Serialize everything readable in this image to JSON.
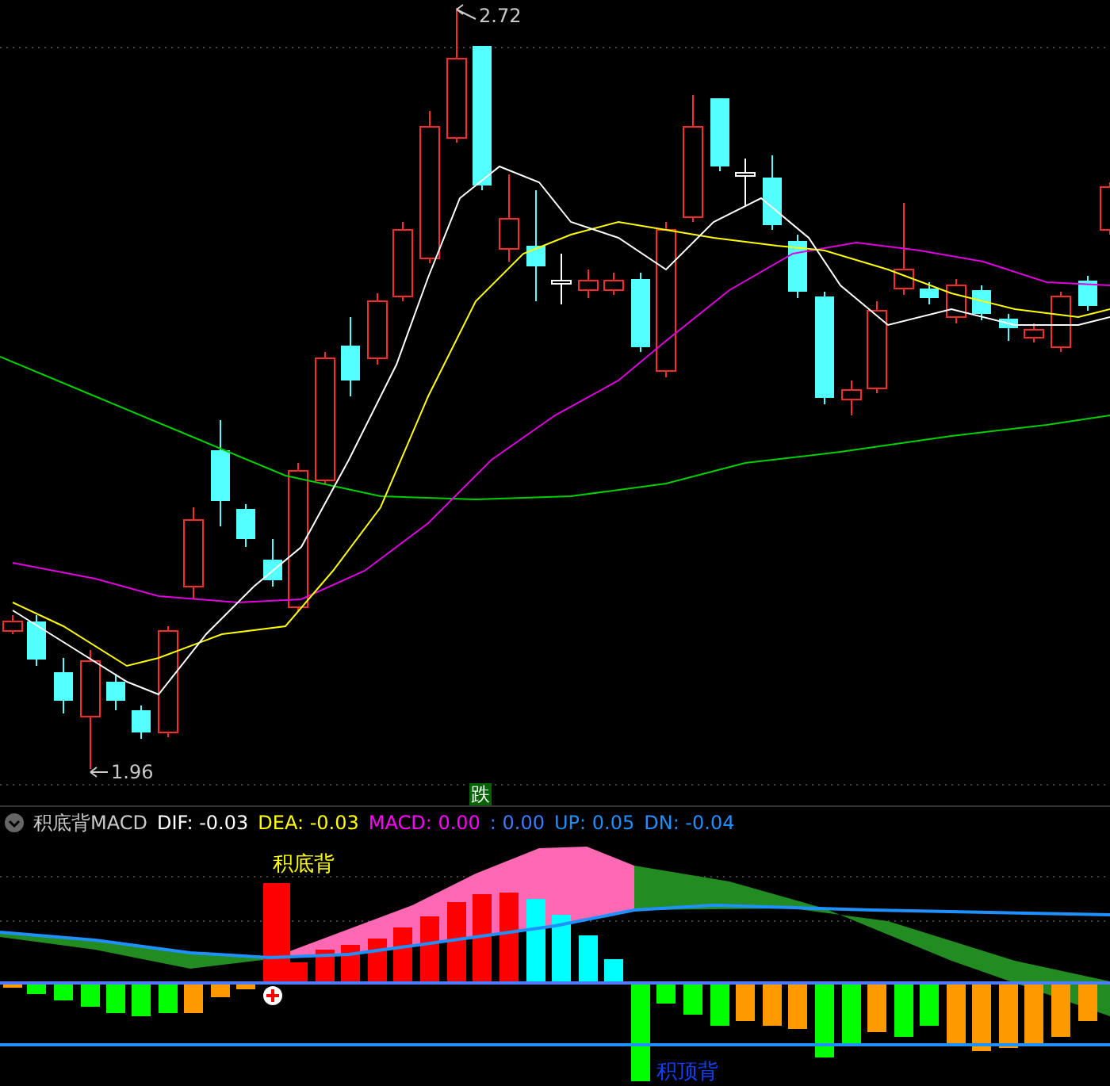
{
  "price_chart": {
    "high_label": "2.72",
    "low_label": "1.96",
    "signal_badge": "跌"
  },
  "indicator_header": {
    "name": "积底背MACD",
    "items": [
      {
        "text": "DIF: -0.03",
        "color": "#ffffff"
      },
      {
        "text": "DEA: -0.03",
        "color": "#ffff00"
      },
      {
        "text": "MACD: 0.00",
        "color": "#ff00ff"
      },
      {
        "text": ": 0.00",
        "color": "#3b7bff"
      },
      {
        "text": "UP: 0.05",
        "color": "#1e90ff"
      },
      {
        "text": "DN: -0.04",
        "color": "#1e90ff"
      }
    ]
  },
  "indicator_chart": {
    "bottom_divergence_label": "积底背",
    "top_divergence_label": "积顶背"
  }
}
